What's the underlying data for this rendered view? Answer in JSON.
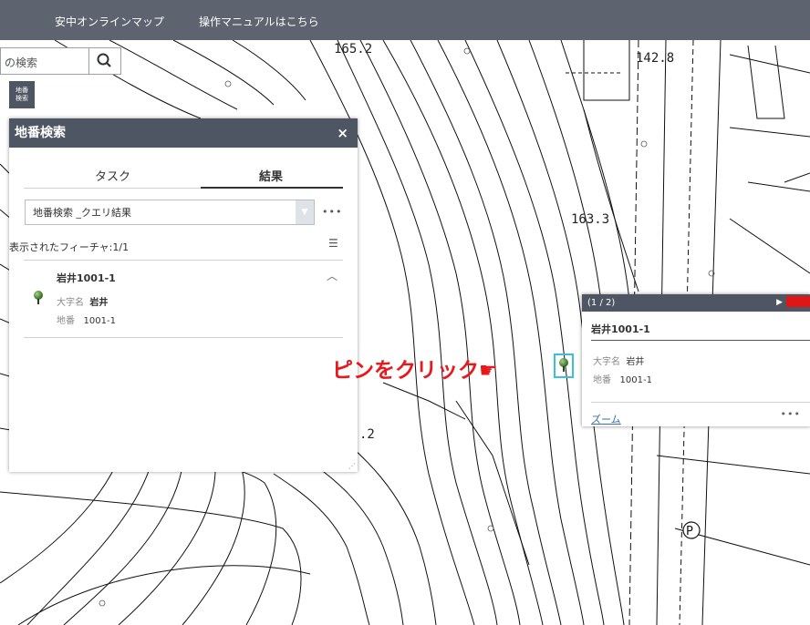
{
  "topbar": {
    "app_title": "安中オンラインマップ",
    "manual_link": "操作マニュアルはこちら"
  },
  "search": {
    "value": "の検索",
    "icon": "search-icon"
  },
  "widget_button": {
    "label_line1": "地番",
    "label_line2": "検索"
  },
  "map": {
    "elevations": [
      "165.2",
      "142.8",
      "163.3",
      ".2"
    ],
    "parking_symbol": "P",
    "callout_text": "ピンをクリック☛"
  },
  "panel": {
    "title": "地番検索",
    "close": "×",
    "tabs": [
      {
        "label": "タスク",
        "active": false
      },
      {
        "label": "結果",
        "active": true
      }
    ],
    "result_set": "地番検索 _クエリ結果",
    "more": "•••",
    "feature_count": "表示されたフィーチャ:1/1",
    "result": {
      "title": "岩井1001-1",
      "fields": [
        {
          "key": "大字名",
          "value": "岩井"
        },
        {
          "key": "地番",
          "value": "1001-1"
        }
      ]
    }
  },
  "popup": {
    "pager": "(1 / 2)",
    "next": "▶",
    "title": "岩井1001-1",
    "fields": [
      {
        "key": "大字名",
        "value": "岩井"
      },
      {
        "key": "地番",
        "value": "1001-1"
      }
    ],
    "zoom": "ズーム",
    "more": "•••"
  }
}
